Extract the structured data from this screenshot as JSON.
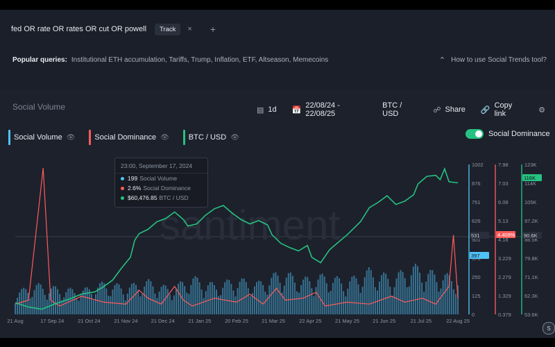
{
  "query": {
    "text": "fed OR rate OR rates OR cut OR powell",
    "track_label": "Track",
    "close": "×",
    "add": "+"
  },
  "popular": {
    "label": "Popular queries:",
    "items": "Institutional ETH accumulation, Tariffs, Trump, Inflation, ETF, Altseason, Memecoins",
    "help": "How to use Social Trends tool?"
  },
  "panel": {
    "title": "Social Volume"
  },
  "toolbar": {
    "interval": "1d",
    "date_range": "22/08/24 - 22/08/25",
    "pair": "BTC / USD",
    "share": "Share",
    "copy_link": "Copy link"
  },
  "legend": [
    {
      "label": "Social Volume",
      "color": "#4fc3f7"
    },
    {
      "label": "Social Dominance",
      "color": "#ff5b5b"
    },
    {
      "label": "BTC / USD",
      "color": "#26c281"
    }
  ],
  "toggle": {
    "label": "Social Dominance",
    "on": true
  },
  "tooltip": {
    "title": "23:00, September 17, 2024",
    "rows": [
      {
        "value": "199",
        "label": "Social Volume",
        "color": "#4fc3f7"
      },
      {
        "value": "2.6%",
        "label": "Social Dominance",
        "color": "#ff5b5b"
      },
      {
        "value": "$60,476.85",
        "label": "BTC / USD",
        "color": "#26c281"
      }
    ]
  },
  "watermark": "santiment",
  "corner_badge": "S",
  "chart_data": {
    "type": "line",
    "x_labels": [
      "21 Aug",
      "17 Sep 24",
      "21 Oct 24",
      "21 Nov 24",
      "21 Dec 24",
      "21 Jan 25",
      "20 Feb 25",
      "21 Mar 25",
      "22 Apr 25",
      "21 May 25",
      "21 Jun 25",
      "21 Jul 25",
      "22 Aug 25"
    ],
    "axes": {
      "social_volume": {
        "ticks": [
          "1002",
          "876",
          "751",
          "626",
          "501",
          "376",
          "250",
          "125",
          "0"
        ],
        "current": "531",
        "hover": "397",
        "color": "#4fc3f7"
      },
      "social_dominance": {
        "ticks": [
          "7.98",
          "7.03",
          "6.08",
          "5.13",
          "4.18",
          "3.229",
          "2.279",
          "1.329",
          "0.379"
        ],
        "current": "4.409%",
        "color": "#ff5b5b"
      },
      "btc_usd": {
        "ticks": [
          "123K",
          "114K",
          "105K",
          "97.2K",
          "88.5K",
          "79.8K",
          "71.1K",
          "62.3K",
          "53.6K"
        ],
        "current": "116K",
        "hover": "90.6K",
        "color": "#26c281"
      }
    },
    "series": [
      {
        "name": "BTC / USD",
        "unit": "USD",
        "points": [
          [
            0,
            59000
          ],
          [
            0.03,
            57000
          ],
          [
            0.06,
            56000
          ],
          [
            0.09,
            58500
          ],
          [
            0.12,
            60500
          ],
          [
            0.15,
            63000
          ],
          [
            0.18,
            64000
          ],
          [
            0.2,
            66500
          ],
          [
            0.22,
            69500
          ],
          [
            0.24,
            75000
          ],
          [
            0.26,
            80000
          ],
          [
            0.27,
            88000
          ],
          [
            0.28,
            91000
          ],
          [
            0.3,
            93000
          ],
          [
            0.32,
            96500
          ],
          [
            0.34,
            98000
          ],
          [
            0.36,
            101000
          ],
          [
            0.38,
            97500
          ],
          [
            0.39,
            94500
          ],
          [
            0.41,
            95500
          ],
          [
            0.43,
            99500
          ],
          [
            0.45,
            102500
          ],
          [
            0.47,
            104000
          ],
          [
            0.49,
            100500
          ],
          [
            0.51,
            97500
          ],
          [
            0.53,
            95500
          ],
          [
            0.55,
            97000
          ],
          [
            0.57,
            95000
          ],
          [
            0.58,
            90500
          ],
          [
            0.6,
            86500
          ],
          [
            0.62,
            84500
          ],
          [
            0.64,
            83000
          ],
          [
            0.66,
            85500
          ],
          [
            0.67,
            80000
          ],
          [
            0.69,
            77500
          ],
          [
            0.71,
            83500
          ],
          [
            0.73,
            87000
          ],
          [
            0.75,
            90500
          ],
          [
            0.77,
            94500
          ],
          [
            0.78,
            96500
          ],
          [
            0.8,
            103000
          ],
          [
            0.82,
            105500
          ],
          [
            0.84,
            108500
          ],
          [
            0.86,
            104500
          ],
          [
            0.88,
            106000
          ],
          [
            0.9,
            109000
          ],
          [
            0.91,
            114000
          ],
          [
            0.93,
            117500
          ],
          [
            0.95,
            118000
          ],
          [
            0.96,
            116000
          ],
          [
            0.97,
            121000
          ],
          [
            0.98,
            115000
          ],
          [
            1,
            114500
          ]
        ]
      },
      {
        "name": "Social Dominance",
        "unit": "%",
        "points": [
          [
            0,
            0.9
          ],
          [
            0.03,
            1.1
          ],
          [
            0.063,
            7.8
          ],
          [
            0.08,
            1.1
          ],
          [
            0.1,
            0.8
          ],
          [
            0.15,
            1.3
          ],
          [
            0.2,
            1.0
          ],
          [
            0.25,
            0.9
          ],
          [
            0.28,
            1.6
          ],
          [
            0.3,
            1.2
          ],
          [
            0.33,
            0.9
          ],
          [
            0.36,
            1.8
          ],
          [
            0.38,
            1.1
          ],
          [
            0.4,
            0.8
          ],
          [
            0.45,
            1.2
          ],
          [
            0.5,
            1.0
          ],
          [
            0.53,
            1.4
          ],
          [
            0.56,
            0.9
          ],
          [
            0.59,
            1.7
          ],
          [
            0.61,
            1.1
          ],
          [
            0.65,
            1.2
          ],
          [
            0.68,
            1.5
          ],
          [
            0.7,
            0.8
          ],
          [
            0.75,
            1.0
          ],
          [
            0.8,
            0.9
          ],
          [
            0.85,
            1.3
          ],
          [
            0.88,
            1.0
          ],
          [
            0.92,
            1.2
          ],
          [
            0.95,
            0.9
          ],
          [
            0.98,
            1.8
          ],
          [
            0.99,
            4.4
          ],
          [
            1,
            1.2
          ]
        ]
      },
      {
        "name": "Social Volume",
        "unit": "count",
        "points": [
          [
            0,
            120
          ],
          [
            0.05,
            160
          ],
          [
            0.1,
            140
          ],
          [
            0.15,
            130
          ],
          [
            0.2,
            170
          ],
          [
            0.25,
            150
          ],
          [
            0.3,
            180
          ],
          [
            0.35,
            140
          ],
          [
            0.4,
            200
          ],
          [
            0.45,
            160
          ],
          [
            0.5,
            190
          ],
          [
            0.55,
            170
          ],
          [
            0.6,
            230
          ],
          [
            0.65,
            190
          ],
          [
            0.7,
            210
          ],
          [
            0.75,
            180
          ],
          [
            0.8,
            240
          ],
          [
            0.85,
            200
          ],
          [
            0.9,
            260
          ],
          [
            0.95,
            220
          ],
          [
            1,
            200
          ]
        ]
      }
    ]
  }
}
